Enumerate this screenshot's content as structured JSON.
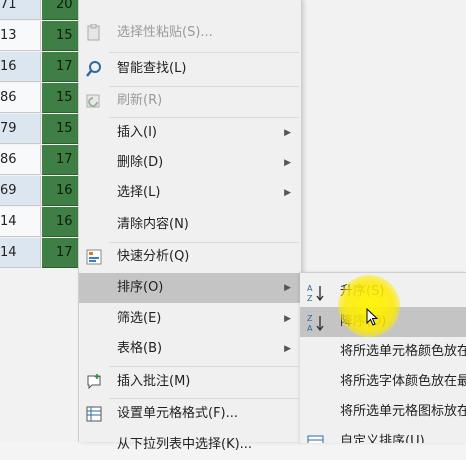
{
  "sheet": {
    "colA": [
      "71",
      "13",
      "16",
      "86",
      "79",
      "86",
      "69",
      "14",
      "14"
    ],
    "colB": [
      "20",
      "15",
      "17",
      "15",
      "15",
      "17",
      "16",
      "16",
      "17"
    ],
    "colA_blue": [
      true,
      false,
      true,
      false,
      true,
      false,
      true,
      false,
      true
    ]
  },
  "menu": {
    "items": [
      {
        "label": "选择性粘贴(S)...",
        "icon": "paste-special-icon",
        "disabled": true
      },
      {
        "label": "智能查找(L)",
        "icon": "smart-lookup-icon",
        "disabled": false
      },
      {
        "label": "刷新(R)",
        "icon": "refresh-icon",
        "disabled": true
      },
      {
        "label": "插入(I)",
        "icon": "",
        "disabled": false,
        "submenu": true
      },
      {
        "label": "删除(D)",
        "icon": "",
        "disabled": false,
        "submenu": true
      },
      {
        "label": "选择(L)",
        "icon": "",
        "disabled": false,
        "submenu": true
      },
      {
        "label": "清除内容(N)",
        "icon": "",
        "disabled": false
      },
      {
        "label": "快速分析(Q)",
        "icon": "quick-analysis-icon",
        "disabled": false
      },
      {
        "label": "排序(O)",
        "icon": "",
        "disabled": false,
        "submenu": true,
        "highlighted": true
      },
      {
        "label": "筛选(E)",
        "icon": "",
        "disabled": false,
        "submenu": true
      },
      {
        "label": "表格(B)",
        "icon": "",
        "disabled": false,
        "submenu": true
      },
      {
        "label": "插入批注(M)",
        "icon": "insert-comment-icon",
        "disabled": false
      },
      {
        "label": "设置单元格格式(F)...",
        "icon": "format-cells-icon",
        "disabled": false
      },
      {
        "label": "从下拉列表中选择(K)...",
        "icon": "",
        "disabled": false
      }
    ]
  },
  "submenu": {
    "items": [
      {
        "label": "升序(S)",
        "icon": "sort-ascending-icon"
      },
      {
        "label": "降序(O)",
        "icon": "sort-descending-icon",
        "highlighted": true
      },
      {
        "label": "将所选单元格颜色放在最前面(C)",
        "icon": ""
      },
      {
        "label": "将所选字体颜色放在最前面(F)",
        "icon": ""
      },
      {
        "label": "将所选单元格图标放在最前面(I)",
        "icon": ""
      },
      {
        "label": "自定义排序(U)...",
        "icon": "custom-sort-icon"
      }
    ]
  },
  "colors": {
    "green_cell": "#3f7f45",
    "blue_cell": "#dce6f1",
    "highlight": "#c4c4c4",
    "spotlight": "#fff200"
  }
}
